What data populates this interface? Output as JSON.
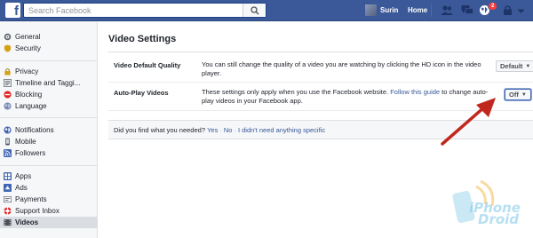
{
  "header": {
    "logo": "f",
    "search_placeholder": "Search Facebook",
    "user_name": "Surin",
    "home_label": "Home",
    "notification_count": "2"
  },
  "sidebar": {
    "groups": [
      [
        {
          "label": "General",
          "icon": "gear-icon"
        },
        {
          "label": "Security",
          "icon": "shield-icon"
        }
      ],
      [
        {
          "label": "Privacy",
          "icon": "lock-icon"
        },
        {
          "label": "Timeline and Taggi...",
          "icon": "timeline-icon"
        },
        {
          "label": "Blocking",
          "icon": "block-icon"
        },
        {
          "label": "Language",
          "icon": "globe-icon"
        }
      ],
      [
        {
          "label": "Notifications",
          "icon": "globe-notif-icon"
        },
        {
          "label": "Mobile",
          "icon": "mobile-icon"
        },
        {
          "label": "Followers",
          "icon": "rss-icon"
        }
      ],
      [
        {
          "label": "Apps",
          "icon": "apps-icon"
        },
        {
          "label": "Ads",
          "icon": "ads-icon"
        },
        {
          "label": "Payments",
          "icon": "payments-icon"
        },
        {
          "label": "Support Inbox",
          "icon": "lifebuoy-icon"
        },
        {
          "label": "Videos",
          "icon": "video-icon",
          "active": true
        }
      ]
    ]
  },
  "main": {
    "title": "Video Settings",
    "settings": [
      {
        "label": "Video Default Quality",
        "desc": "You can still change the quality of a video you are watching by clicking the HD icon in the video player.",
        "value": "Default"
      },
      {
        "label": "Auto-Play Videos",
        "desc_before": "These settings only apply when you use the Facebook website. ",
        "desc_link": "Follow this guide",
        "desc_after": " to change auto-play videos in your Facebook app.",
        "value": "Off"
      }
    ],
    "feedback": {
      "question": "Did you find what you needed?",
      "yes": "Yes",
      "no": "No",
      "didnt_need": "I didn't need anything specific",
      "separator": "·"
    }
  },
  "annotation": {
    "arrow_color": "#c0281d"
  },
  "watermark": {
    "line1": "iPhone",
    "line2": "Droid",
    "color": "#7ec6e8"
  },
  "colors": {
    "brand": "#3b5998",
    "link": "#365899",
    "badge": "#fa3e3e"
  }
}
